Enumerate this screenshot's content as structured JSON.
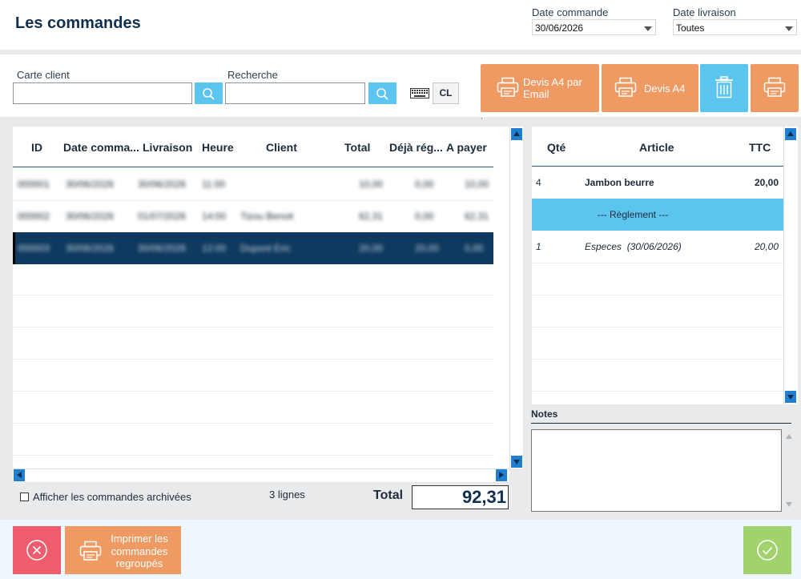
{
  "header": {
    "title": "Les commandes",
    "date_commande_label": "Date commande",
    "date_commande_value": "30/06/2026",
    "date_livraison_label": "Date livraison",
    "date_livraison_value": "Toutes"
  },
  "filters": {
    "carte_client_label": "Carte client",
    "recherche_label": "Recherche",
    "cl_label": "CL"
  },
  "actions": {
    "devis_email_label": "Devis A4 par Email",
    "devis_a4_label": "Devis A4"
  },
  "orders_table": {
    "columns": [
      "ID",
      "Date comma...",
      "Livraison",
      "Heure",
      "Client",
      "Total",
      "Déjà rég...",
      "A payer"
    ],
    "rows": [
      {
        "id": "000001",
        "date": "30/06/2026",
        "livraison": "30/06/2026",
        "heure": "11:00",
        "client": "",
        "total": "10,00",
        "deja": "0,00",
        "apayer": "10,00",
        "selected": false
      },
      {
        "id": "000002",
        "date": "30/06/2026",
        "livraison": "01/07/2026",
        "heure": "14:00",
        "client": "Tizou Benoit",
        "total": "62,31",
        "deja": "0,00",
        "apayer": "62,31",
        "selected": false
      },
      {
        "id": "000003",
        "date": "30/06/2026",
        "livraison": "30/06/2026",
        "heure": "12:00",
        "client": "Dupont Eric",
        "total": "20,00",
        "deja": "20,00",
        "apayer": "0,00",
        "selected": true
      }
    ]
  },
  "archived": {
    "label": "Afficher les commandes archivées",
    "checked": false
  },
  "count_label": "3 lignes",
  "total_label": "Total",
  "total_value": "92,31",
  "detail_table": {
    "columns": [
      "Qté",
      "Article",
      "TTC"
    ],
    "rows": [
      {
        "qte": "4",
        "article": "Jambon beurre",
        "ttc": "20,00",
        "type": "item"
      },
      {
        "qte": "",
        "article": "--- Règlement ---",
        "ttc": "",
        "type": "separator"
      },
      {
        "qte": "1",
        "article": "Especes  (30/06/2026)",
        "ttc": "20,00",
        "type": "payment"
      }
    ]
  },
  "notes_label": "Notes",
  "bottom": {
    "print_grouped_label": "Imprimer les commandes regroupés"
  },
  "colors": {
    "accent_blue": "#5bc4ef",
    "orange": "#f09a63",
    "red": "#ee5c6e",
    "green": "#a2d26d",
    "navy": "#0e3a5f"
  }
}
